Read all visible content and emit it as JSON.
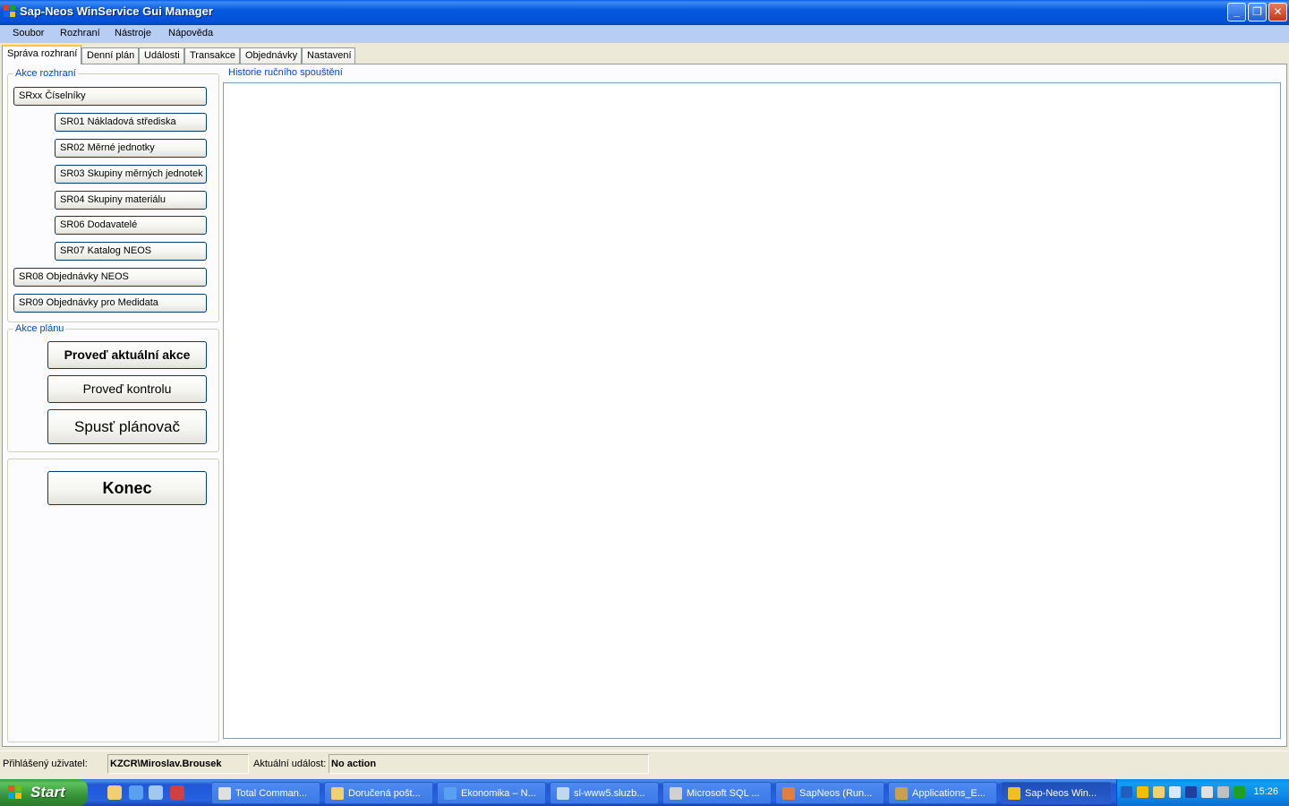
{
  "window": {
    "title": "Sap-Neos WinService Gui Manager",
    "buttons": [
      "_",
      "❐",
      "✕"
    ]
  },
  "menu": [
    "Soubor",
    "Rozhraní",
    "Nástroje",
    "Nápověda"
  ],
  "tabs": [
    "Správa rozhraní",
    "Denní plán",
    "Události",
    "Transakce",
    "Objednávky",
    "Nastavení"
  ],
  "active_tab": "Správa rozhraní",
  "interface_actions": {
    "legend": "Akce rozhraní",
    "buttons": [
      "SRxx Číselníky",
      "SR01 Nákladová střediska",
      "SR02 Měrné jednotky",
      "SR03 Skupiny měrných jednotek",
      "SR04 Skupiny materiálu",
      "SR06 Dodavatelé",
      "SR07 Katalog NEOS",
      "SR08 Objednávky NEOS",
      "SR09 Objednávky pro Medidata"
    ]
  },
  "plan_actions": {
    "legend": "Akce plánu",
    "run_current": "Proveď aktuální akce",
    "run_check": "Proveď kontrolu",
    "start_scheduler": "Spusť plánovač"
  },
  "exit_button": "Konec",
  "history": {
    "legend": "Historie ručního spouštění"
  },
  "status": {
    "user_label": "Přihlášený uživatel:",
    "user_value": "KZCR\\Miroslav.Brousek",
    "event_label": "Aktuální událost:",
    "event_value": "No action"
  },
  "taskbar": {
    "start": "Start",
    "tasks": [
      "Total Comman...",
      "Doručená pošt...",
      "Ekonomika – N...",
      "sl-www5.sluzb...",
      "Microsoft SQL ...",
      "SapNeos (Run...",
      "Applications_E...",
      "Sap-Neos Win..."
    ],
    "active_task": "Sap-Neos Win...",
    "clock": "15:26"
  },
  "colors": {
    "title_blue": "#0450d8",
    "legend_blue": "#0046d5",
    "start_green": "#389438",
    "taskbar_blue": "#2663e0"
  }
}
